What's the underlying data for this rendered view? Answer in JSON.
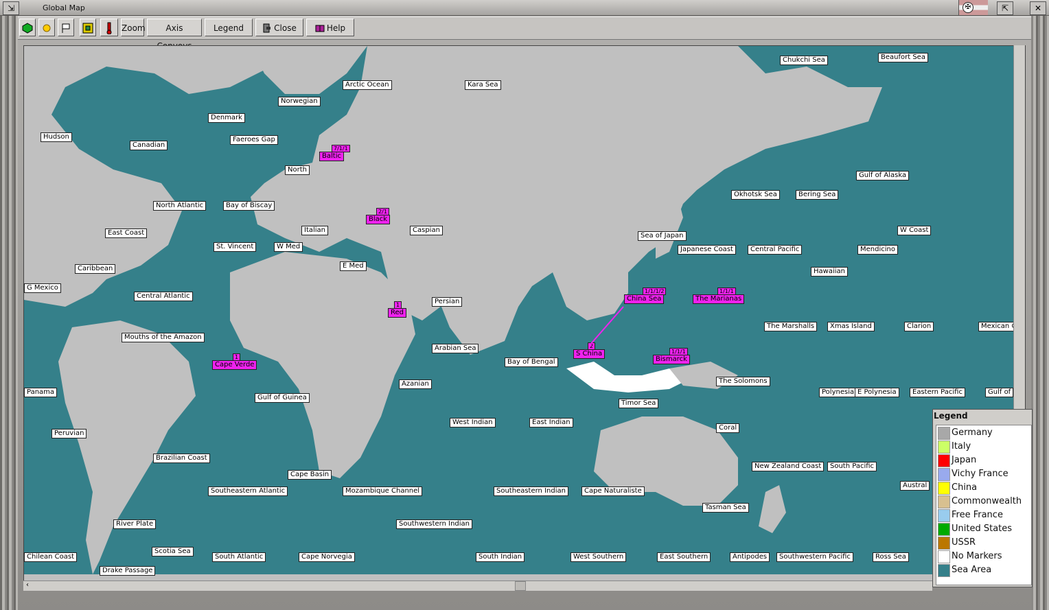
{
  "window": {
    "title": "Global Map"
  },
  "toolbar": {
    "zoom_label": "Zoom",
    "axis_convoys_label": "Axis Convoys",
    "legend_label": "Legend",
    "close_label": "Close",
    "help_label": "Help"
  },
  "map": {
    "sea_areas": [
      "Chukchi Sea",
      "Beaufort Sea",
      "Arctic Ocean",
      "Kara Sea",
      "Norwegian",
      "Denmark",
      "Hudson",
      "Canadian",
      "Faeroes Gap",
      "North",
      "Baltic",
      "North Atlantic",
      "Bay of Biscay",
      "Black",
      "Caspian",
      "East Coast",
      "St. Vincent",
      "W Med",
      "Italian",
      "Caribbean",
      "E Med",
      "Central Atlantic",
      "G Mexico",
      "Red",
      "Persian",
      "Mouths of the Amazon",
      "Cape Verde",
      "Arabian Sea",
      "Bay of Bengal",
      "Azanian",
      "Gulf of Guinea",
      "Panama",
      "Peruvian",
      "Brazilian Coast",
      "Cape Basin",
      "Southeastern Atlantic",
      "Mozambique Channel",
      "West Indian",
      "East Indian",
      "Southeastern Indian",
      "Cape Naturaliste",
      "River Plate",
      "Southwestern Indian",
      "Scotia Sea",
      "Chilean Coast",
      "South Atlantic",
      "Cape Norvegia",
      "South Indian",
      "West Southern",
      "East Southern",
      "Antipodes",
      "Southwestern Pacific",
      "Ross Sea",
      "Drake Passage",
      "Sea of Japan",
      "Japanese Coast",
      "Okhotsk Sea",
      "Bering Sea",
      "Gulf of Alaska",
      "W Coast",
      "Central Pacific",
      "Mendicino",
      "Hawaiian",
      "China Sea",
      "The Marianas",
      "The Marshalls",
      "Xmas Island",
      "Clarion",
      "Mexican Coast",
      "S China",
      "Bismarck",
      "The Solomons",
      "Polynesia",
      "E Polynesia",
      "Eastern Pacific",
      "Gulf of",
      "Timor Sea",
      "Coral",
      "New Zealand Coast",
      "South Pacific",
      "Austral",
      "Tasman Sea"
    ],
    "markers": [
      {
        "area": "Baltic",
        "code": "7/1/1"
      },
      {
        "area": "Black",
        "code": "2/1"
      },
      {
        "area": "Red",
        "code": "1"
      },
      {
        "area": "Cape Verde",
        "code": "1"
      },
      {
        "area": "China Sea",
        "code": "1/1/1/2"
      },
      {
        "area": "The Marianas",
        "code": "1/1/1"
      },
      {
        "area": "S China",
        "code": "2"
      },
      {
        "area": "Bismarck",
        "code": "1/1/1"
      }
    ]
  },
  "legend": {
    "title": "Legend",
    "items": [
      {
        "label": "Germany",
        "color": "#a8a8a8"
      },
      {
        "label": "Italy",
        "color": "#ccff66"
      },
      {
        "label": "Japan",
        "color": "#ff0000"
      },
      {
        "label": "Vichy France",
        "color": "#99aaee"
      },
      {
        "label": "China",
        "color": "#ffff00"
      },
      {
        "label": "Commonwealth",
        "color": "#d8c090"
      },
      {
        "label": "Free France",
        "color": "#99ccee"
      },
      {
        "label": "United States",
        "color": "#00aa00"
      },
      {
        "label": "USSR",
        "color": "#bb7700"
      },
      {
        "label": "No Markers",
        "color": "#ffffff"
      },
      {
        "label": "Sea Area",
        "color": "#35808a"
      }
    ]
  },
  "colors": {
    "sea": "#35808a",
    "land": "#c0c0c0",
    "marker": "#ee22ee"
  }
}
